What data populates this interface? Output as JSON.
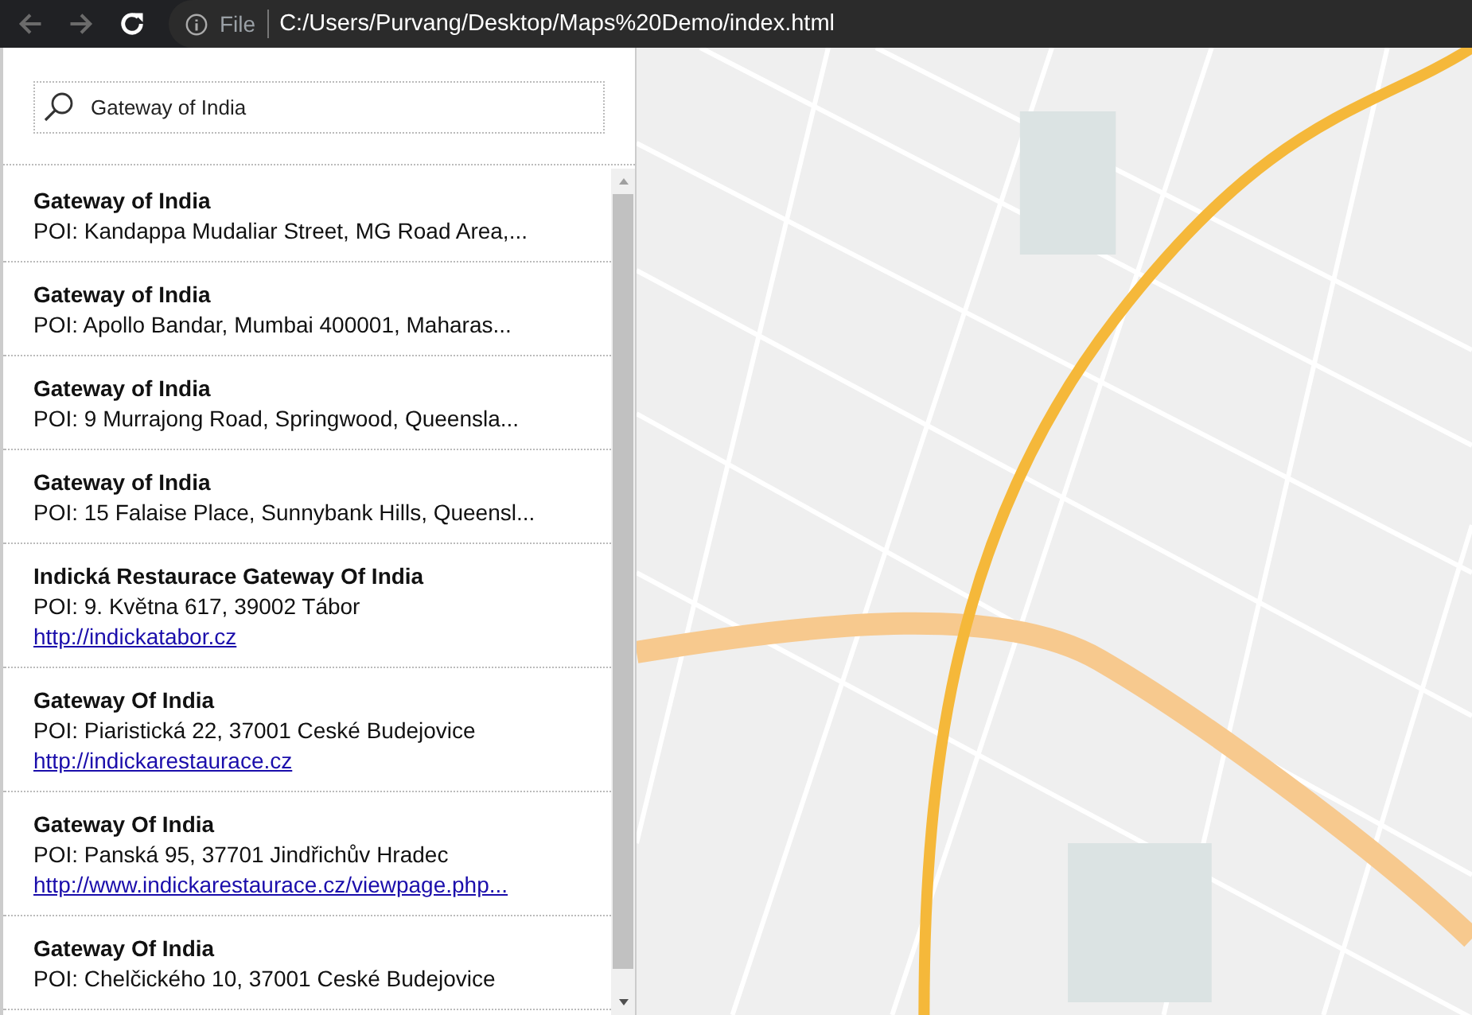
{
  "browser": {
    "scheme": "File",
    "url": "C:/Users/Purvang/Desktop/Maps%20Demo/index.html"
  },
  "search": {
    "value": "Gateway of India"
  },
  "results": [
    {
      "title": "Gateway of India",
      "address": "POI: Kandappa Mudaliar Street, MG Road Area,..."
    },
    {
      "title": "Gateway of India",
      "address": "POI: Apollo Bandar, Mumbai 400001, Maharas..."
    },
    {
      "title": "Gateway of India",
      "address": "POI: 9 Murrajong Road, Springwood, Queensla..."
    },
    {
      "title": "Gateway of India",
      "address": "POI: 15 Falaise Place, Sunnybank Hills, Queensl..."
    },
    {
      "title": "Indická Restaurace Gateway Of India",
      "address": "POI: 9. Května 617, 39002 Tábor",
      "link": "http://indickatabor.cz"
    },
    {
      "title": "Gateway Of India",
      "address": "POI: Piaristická 22, 37001 Ceské Budejovice",
      "link": "http://indickarestaurace.cz"
    },
    {
      "title": "Gateway Of India",
      "address": "POI: Panská 95, 37701 Jindřichův Hradec",
      "link": "http://www.indickarestaurace.cz/viewpage.php..."
    },
    {
      "title": "Gateway Of India",
      "address": "POI: Chelčického 10, 37001 Ceské Budejovice"
    }
  ]
}
